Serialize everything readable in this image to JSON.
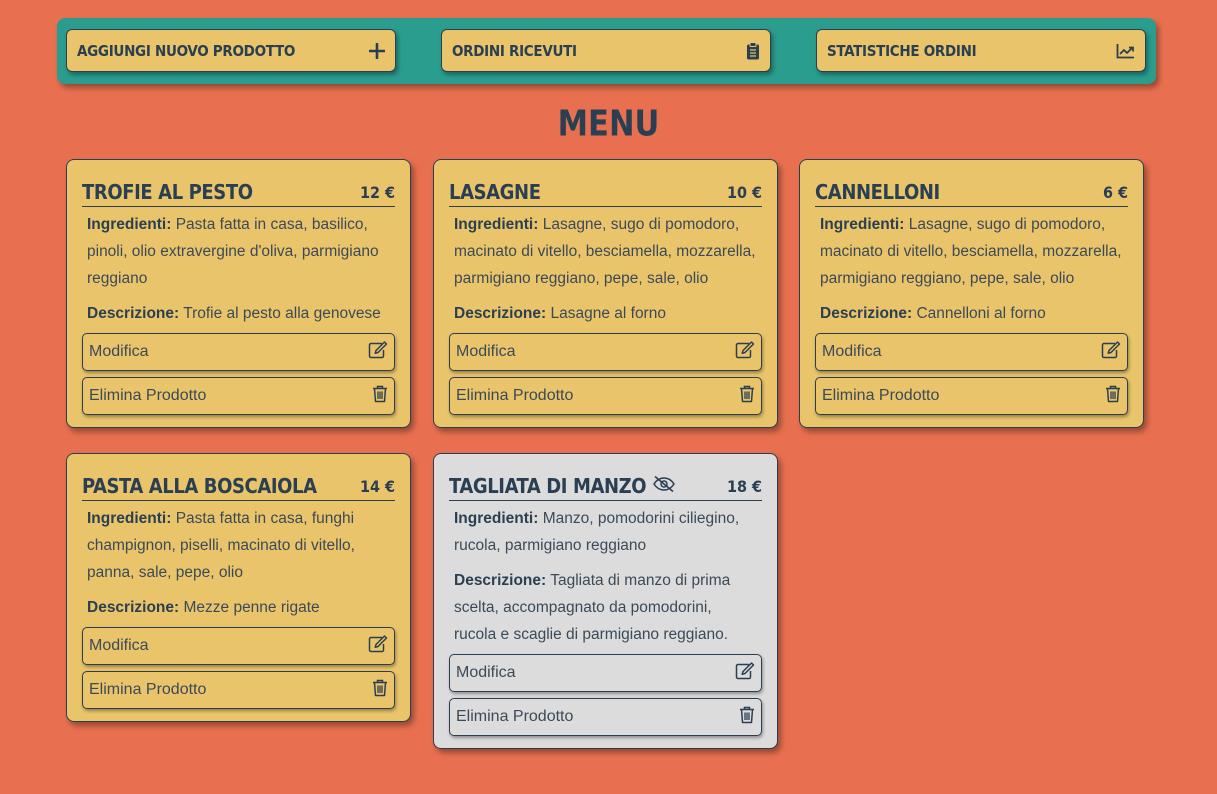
{
  "toolbar": {
    "buttons": [
      {
        "label": "AGGIUNGI NUOVO PRODOTTO",
        "icon": "plus-icon"
      },
      {
        "label": "ORDINI RICEVUTI",
        "icon": "clipboard-icon"
      },
      {
        "label": "STATISTICHE ORDINI",
        "icon": "chart-line-icon"
      }
    ]
  },
  "page_title": "MENU",
  "colors": {
    "background": "#e87050",
    "toolbar": "#2a9d8f",
    "card": "#e9c46a",
    "card_hidden": "#dcdcdc",
    "text": "#2b3f52"
  },
  "labels": {
    "ingredients": "Ingredienti:",
    "description": "Descrizione:",
    "edit": "Modifica",
    "delete": "Elimina Prodotto"
  },
  "products": [
    {
      "name": "TROFIE AL PESTO",
      "price": "12 €",
      "ingredients": "Pasta fatta in casa, basilico, pinoli, olio extravergine d'oliva, parmigiano reggiano",
      "description": "Trofie al pesto alla genovese",
      "hidden": false
    },
    {
      "name": "LASAGNE",
      "price": "10 €",
      "ingredients": "Lasagne, sugo di pomodoro, macinato di vitello, besciamella, mozzarella, parmigiano reggiano, pepe, sale, olio",
      "description": "Lasagne al forno",
      "hidden": false
    },
    {
      "name": "CANNELLONI",
      "price": "6 €",
      "ingredients": "Lasagne, sugo di pomodoro, macinato di vitello, besciamella, mozzarella, parmigiano reggiano, pepe, sale, olio",
      "description": "Cannelloni al forno",
      "hidden": false
    },
    {
      "name": "PASTA ALLA BOSCAIOLA",
      "price": "14 €",
      "ingredients": "Pasta fatta in casa, funghi champignon, piselli, macinato di vitello, panna, sale, pepe, olio",
      "description": "Mezze penne rigate",
      "hidden": false
    },
    {
      "name": "TAGLIATA DI MANZO",
      "price": "18 €",
      "ingredients": "Manzo, pomodorini ciliegino, rucola, parmigiano reggiano",
      "description": "Tagliata di manzo di prima scelta, accompagnato da pomodorini, rucola e scaglie di parmigiano reggiano.",
      "hidden": true,
      "status_icon": "eye-slash-icon"
    }
  ]
}
